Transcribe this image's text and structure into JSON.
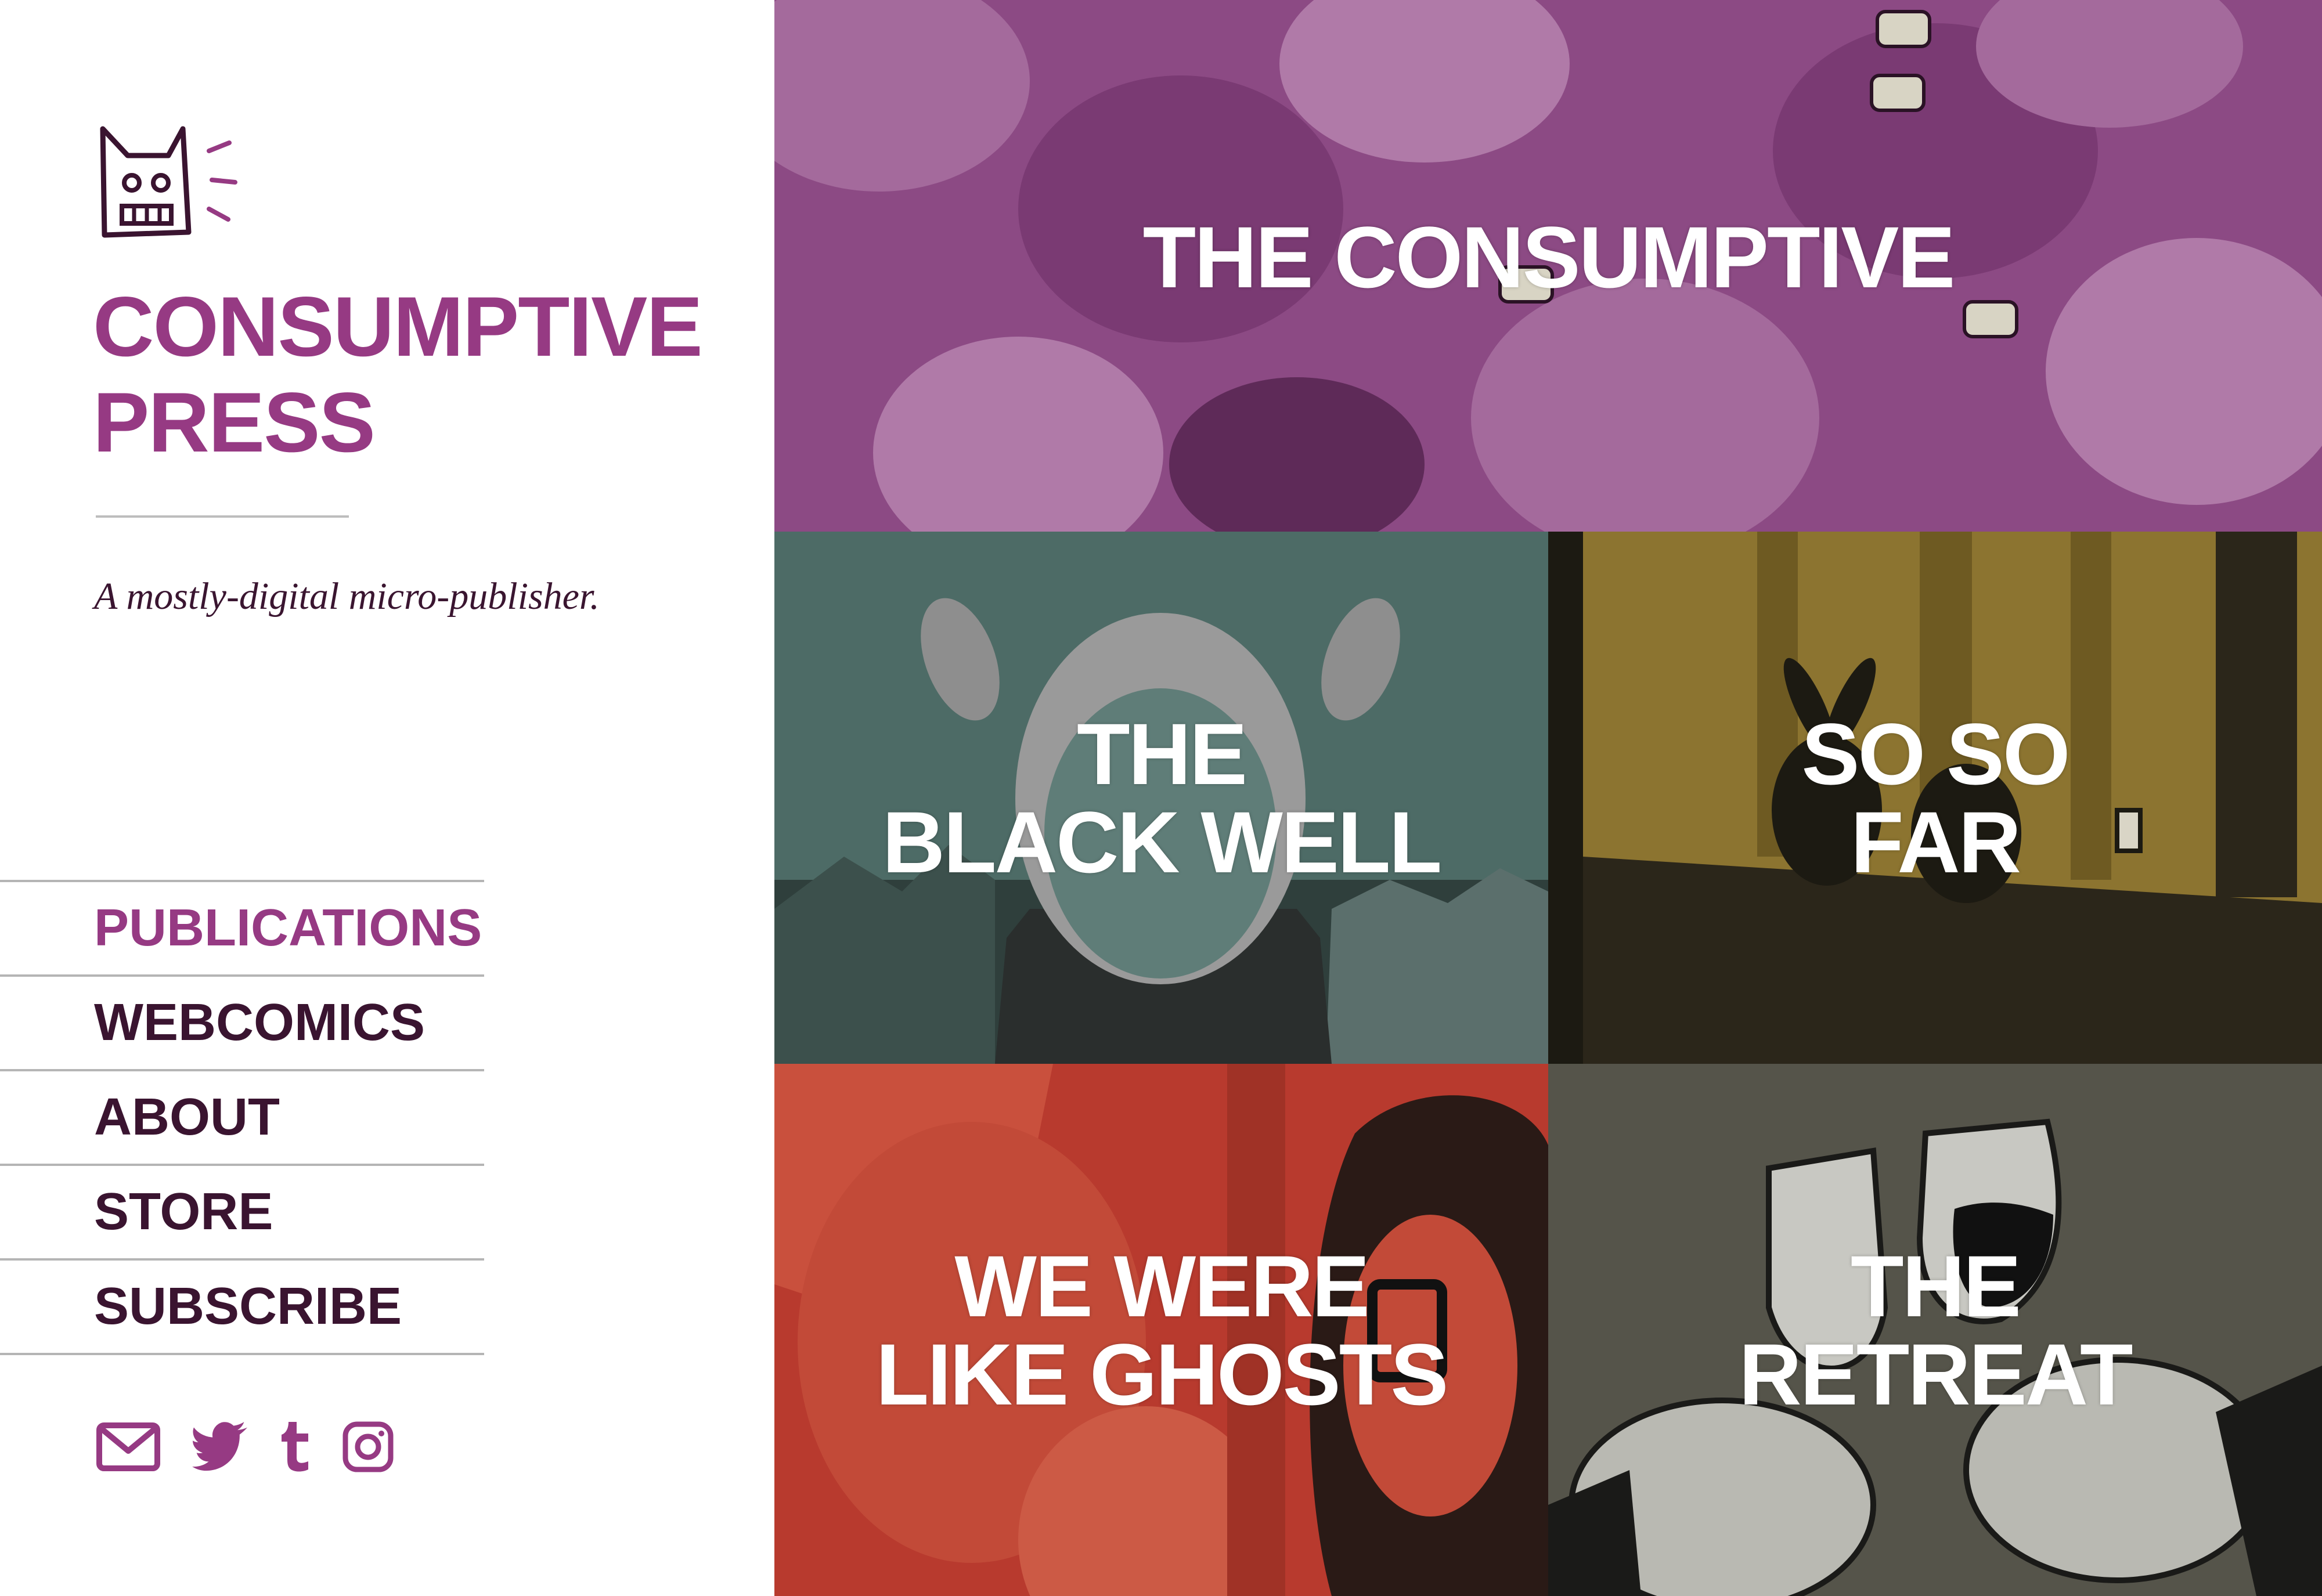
{
  "brand": {
    "title_line1": "CONSUMPTIVE",
    "title_line2": "PRESS",
    "tagline": "A mostly-digital micro-publisher.",
    "logo_icon": "robot-cat-logo-icon"
  },
  "nav": {
    "items": [
      {
        "label": "PUBLICATIONS",
        "active": true
      },
      {
        "label": "WEBCOMICS",
        "active": false
      },
      {
        "label": "ABOUT",
        "active": false
      },
      {
        "label": "STORE",
        "active": false
      },
      {
        "label": "SUBSCRIBE",
        "active": false
      }
    ]
  },
  "social": {
    "icons": [
      "mail-icon",
      "twitter-icon",
      "tumblr-icon",
      "instagram-icon"
    ],
    "color": "#963a83"
  },
  "publications": [
    {
      "label": "THE CONSUMPTIVE",
      "color": "#8c4a84"
    },
    {
      "label": "THE\nBLACK WELL",
      "color": "#4d6b66"
    },
    {
      "label": "SO SO\nFAR",
      "color": "#2b261a"
    },
    {
      "label": "WE WERE\nLIKE GHOSTS",
      "color": "#b83a2e"
    },
    {
      "label": "THE\nRETREAT",
      "color": "#55544a"
    }
  ],
  "colors": {
    "accent": "#963a83",
    "nav_text": "#3a1430",
    "divider": "#b5b5b5"
  }
}
